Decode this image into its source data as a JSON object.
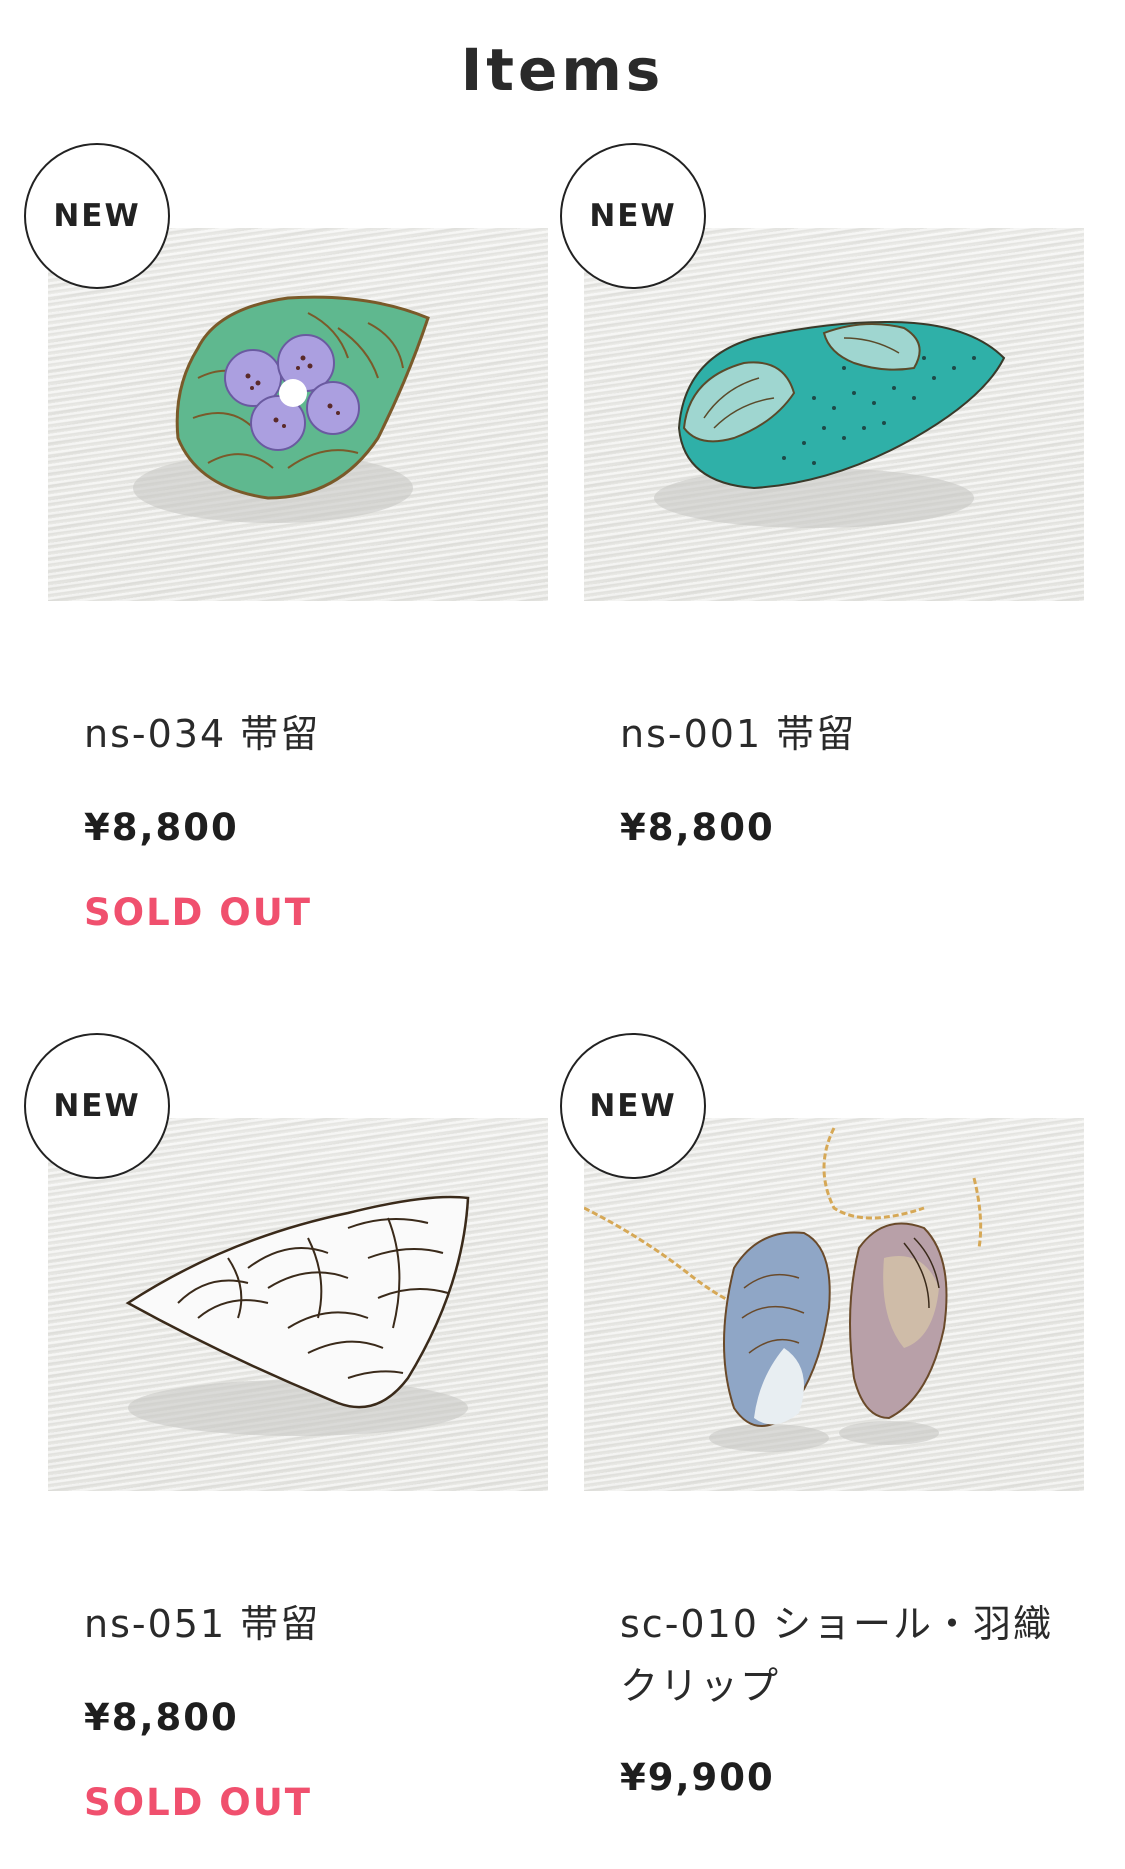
{
  "section_title": "Items",
  "items": [
    {
      "badge": "NEW",
      "name": "ns-034 帯留",
      "price": "¥8,800",
      "status": "SOLD OUT"
    },
    {
      "badge": "NEW",
      "name": "ns-001 帯留",
      "price": "¥8,800",
      "status": ""
    },
    {
      "badge": "NEW",
      "name": "ns-051 帯留",
      "price": "¥8,800",
      "status": "SOLD OUT"
    },
    {
      "badge": "NEW",
      "name": "sc-010 ショール・羽織クリップ",
      "price": "¥9,900",
      "status": ""
    }
  ],
  "colors": {
    "sold_out": "#f0506e",
    "text": "#222222"
  }
}
